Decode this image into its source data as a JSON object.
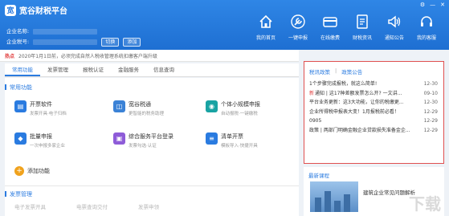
{
  "app": {
    "title": "宽谷财税平台",
    "logo_glyph": "宽",
    "company_name_label": "企业名称:",
    "company_no_label": "企业税号:",
    "switch_button": "切换",
    "add_button": "添加"
  },
  "window_controls": [
    "⚙",
    "—",
    "✕"
  ],
  "nav": [
    {
      "label": "我的首页",
      "icon": "home-icon"
    },
    {
      "label": "一键申报",
      "icon": "wrench-icon"
    },
    {
      "label": "在线缴费",
      "icon": "card-icon"
    },
    {
      "label": "财税资讯",
      "icon": "document-icon"
    },
    {
      "label": "通知公告",
      "icon": "speaker-icon"
    },
    {
      "label": "我的客服",
      "icon": "headset-icon"
    }
  ],
  "notice": {
    "tag": "热点",
    "text": "2020年1月1日前，必须完成自然人税收管理系统扣缴客户端升级"
  },
  "tabs": [
    "常用功能",
    "发票管理",
    "报税认证",
    "金融服务",
    "信息查询"
  ],
  "section_common": "常用功能",
  "cards": [
    {
      "title": "开票软件",
      "sub": "发票开具·电子归档",
      "icon": "invoice-icon",
      "color": "#2a7be0"
    },
    {
      "title": "宽谷税通",
      "sub": "更智能的税务助理",
      "icon": "tax-assistant-icon",
      "color": "#3b82d6"
    },
    {
      "title": "个体小规模申报",
      "sub": "自动报税·一键缴税",
      "icon": "person-icon",
      "color": "#19a3a3"
    },
    {
      "title": "批量申报",
      "sub": "一次申报多家企业",
      "icon": "stack-icon",
      "color": "#2a7be0"
    },
    {
      "title": "综合服务平台登录",
      "sub": "发票勾选·认证",
      "icon": "platform-icon",
      "color": "#8e5cd8"
    },
    {
      "title": "清单开票",
      "sub": "模板导入·快捷开具",
      "icon": "list-icon",
      "color": "#2a7be0"
    }
  ],
  "add_function": "添加功能",
  "section_invoice": "发票管理",
  "invoice_row": [
    "电子发票开具",
    "电票查询交付",
    "发票申领"
  ],
  "news": {
    "tabs": [
      "税讯政策",
      "政策公告"
    ],
    "items": [
      {
        "title": "1个步骤完成报税，就这么简单!",
        "date": "12-30",
        "tag": ""
      },
      {
        "title": "通知 | 这17种差额发票怎么开? 一文讲...",
        "date": "09-10",
        "tag": "新"
      },
      {
        "title": "平台业务更新：这3大功能，让你的税缴更...",
        "date": "12-30",
        "tag": ""
      },
      {
        "title": "企业所得税申报表大变！1月报税前必看！",
        "date": "12-29",
        "tag": ""
      },
      {
        "title": "0905",
        "date": "12-29",
        "tag": ""
      },
      {
        "title": "政策 | 两部门明确金融企业贷款损失准备金企...",
        "date": "12-29",
        "tag": ""
      }
    ]
  },
  "course": {
    "header": "最新课程",
    "title": "建筑企业常见问题解析",
    "watermark": "下载"
  }
}
